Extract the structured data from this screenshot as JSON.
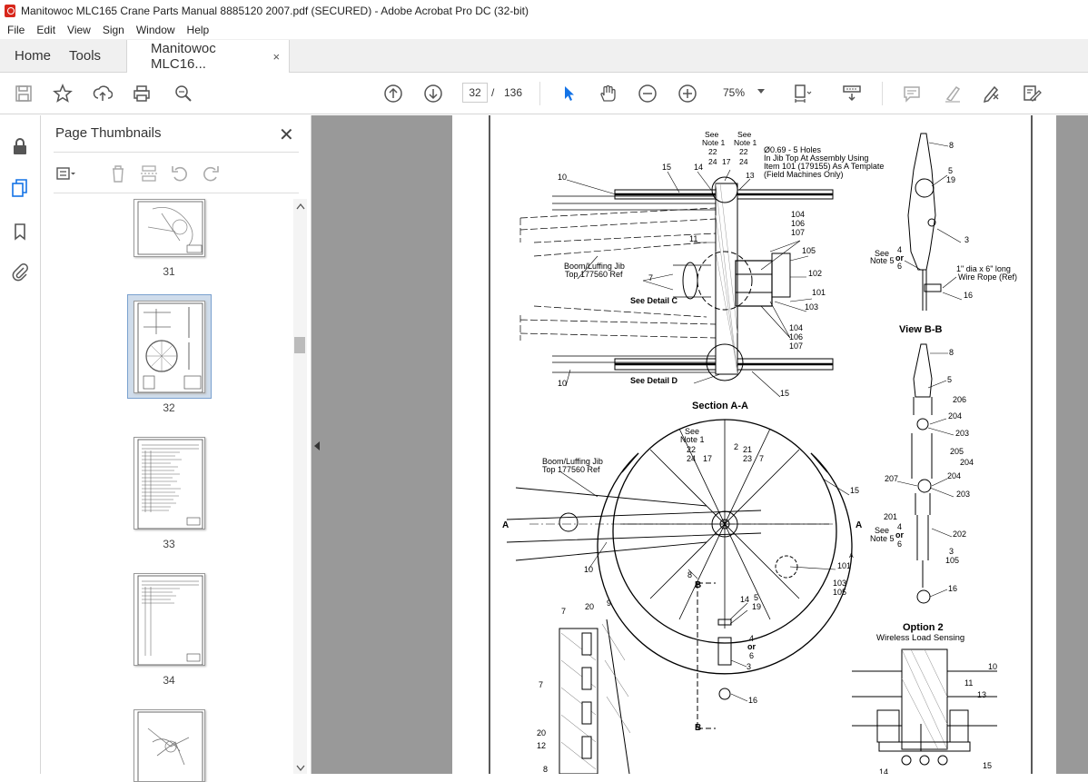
{
  "window": {
    "title": "Manitowoc MLC165 Crane Parts Manual 8885120 2007.pdf (SECURED) - Adobe Acrobat Pro DC (32-bit)"
  },
  "menu": [
    "File",
    "Edit",
    "View",
    "Sign",
    "Window",
    "Help"
  ],
  "tabs": {
    "home": "Home",
    "tools": "Tools",
    "doc": "Manitowoc MLC16...",
    "close": "×"
  },
  "toolbar": {
    "page_current": "32",
    "page_sep": "/",
    "page_total": "136",
    "zoom": "75%"
  },
  "icons": [
    "save-icon",
    "star-icon",
    "upload-icon",
    "print-icon",
    "zoom-search-icon",
    "page-up-icon",
    "page-down-icon",
    "select-arrow-icon",
    "hand-icon",
    "zoom-out-icon",
    "zoom-in-icon",
    "fit-page-icon",
    "scroll-mode-icon",
    "comment-icon",
    "highlight-icon",
    "sign-icon",
    "fill-sign-icon"
  ],
  "sidebar": {
    "panel_title": "Page Thumbnails",
    "close": "✕"
  },
  "thumbnails": [
    {
      "label": "31"
    },
    {
      "label": "32"
    },
    {
      "label": "33"
    },
    {
      "label": "34"
    }
  ],
  "drawing": {
    "top_labels": {
      "see_note1_a": "See",
      "see_note1_a2": "Note 1",
      "n22a": "22",
      "n24a": "24",
      "n17a": "17",
      "see_note1_b": "See",
      "see_note1_b2": "Note 1",
      "n22b": "22",
      "n24b": "24",
      "n13": "13",
      "hole1": "Ø0.69 - 5 Holes",
      "hole2": "In Jib Top At Assembly Using",
      "hole3": "Item 101 (179155) As A Template",
      "hole4": "(Field Machines Only)",
      "n10a": "10",
      "n15a": "15",
      "n14a": "14",
      "n11": "11",
      "n104a": "104",
      "n106a": "106",
      "n107a": "107",
      "n105a": "105",
      "boom1": "Boom/Luffing Jib",
      "boom2": "Top 177560 Ref",
      "n7a": "7",
      "n102": "102",
      "n101a": "101",
      "n103a": "103",
      "detailC": "See Detail C",
      "n104b": "104",
      "n106b": "106",
      "n107b": "107",
      "n10b": "10",
      "detailD": "See Detail D",
      "n15b": "15",
      "sectionAA": "Section  A-A"
    },
    "viewbb": {
      "n8": "8",
      "n5": "5",
      "n19": "19",
      "n3": "3",
      "see": "See",
      "note5": "Note 5",
      "n4": "4",
      "or": "or",
      "n6": "6",
      "wire1": "1\" dia x 6\" long",
      "wire2": "Wire Rope (Ref)",
      "n16": "16",
      "title": "View  B-B"
    },
    "option2": {
      "n8": "8",
      "n5": "5",
      "n206": "206",
      "n204a": "204",
      "n203a": "203",
      "n205": "205",
      "n204b": "204",
      "n207": "207",
      "n204c": "204",
      "n203b": "203",
      "n201": "201",
      "see": "See",
      "note5": "Note 5",
      "n4": "4",
      "or": "or",
      "n6": "6",
      "n202": "202",
      "n3": "3",
      "n105": "105",
      "n16": "16",
      "title": "Option 2",
      "subtitle": "Wireless Load Sensing"
    },
    "wheel": {
      "see": "See",
      "note1": "Note 1",
      "n22": "22",
      "n24": "24",
      "n17": "17",
      "n2": "2",
      "n21": "21",
      "n23": "23",
      "n7": "7",
      "boom1": "Boom/Luffing Jib",
      "boom2": "Top 177560 Ref",
      "n15": "15",
      "A1": "A",
      "A2": "A",
      "n10": "10",
      "n101": "101",
      "Asmall": "A",
      "n103": "103",
      "n105": "105",
      "n8": "8",
      "B1": "B",
      "n14": "14",
      "n5": "5",
      "n19": "19",
      "n4": "4",
      "or": "or",
      "n6": "6",
      "n3": "3",
      "n16": "16",
      "B2": "B"
    },
    "detail": {
      "n7a": "7",
      "n20a": "20",
      "n9": "9",
      "n7b": "7",
      "n20b": "20",
      "n12": "12",
      "n8": "8",
      "n10": "10",
      "n11": "11",
      "n13": "13",
      "n15": "15",
      "n14": "14"
    }
  }
}
